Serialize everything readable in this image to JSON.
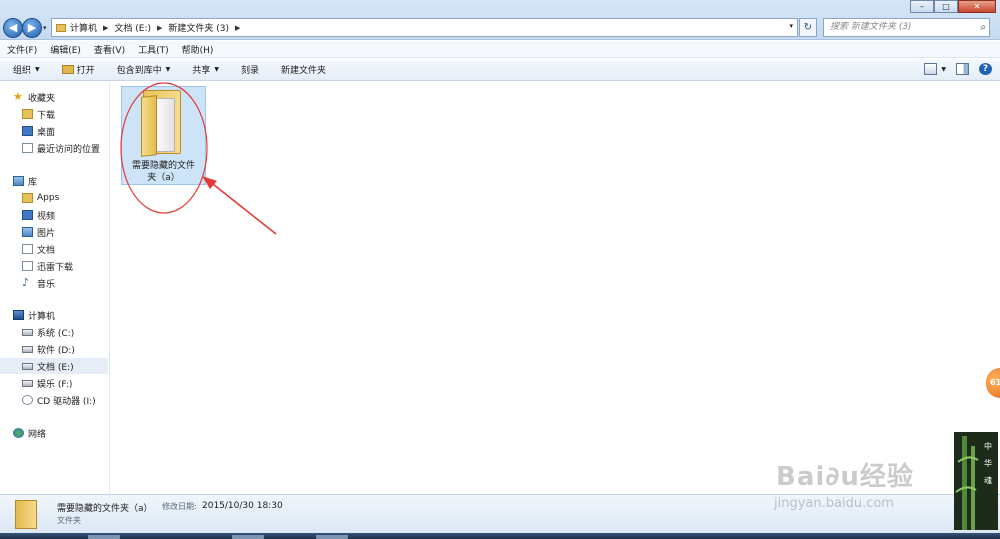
{
  "window": {
    "controls": {
      "minimize": "–",
      "maximize": "□",
      "close": "✕"
    }
  },
  "nav": {
    "back_glyph": "◀",
    "forward_glyph": "▶",
    "dropdown_glyph": "▾",
    "refresh_glyph": "↻"
  },
  "address": {
    "crumbs": [
      {
        "label": "计算机"
      },
      {
        "label": "文档 (E:)"
      },
      {
        "label": "新建文件夹 (3)"
      }
    ],
    "separator": "▶",
    "dropdown": "▾"
  },
  "search": {
    "placeholder": "搜索 新建文件夹 (3)",
    "icon": "search-icon"
  },
  "menubar": [
    "文件(F)",
    "编辑(E)",
    "查看(V)",
    "工具(T)",
    "帮助(H)"
  ],
  "toolbar": {
    "organize": "组织",
    "open": "打开",
    "include_in_library": "包含到库中",
    "share": "共享",
    "burn": "刻录",
    "new_folder": "新建文件夹",
    "caret": "▼",
    "help": "?"
  },
  "sidebar": {
    "favorites": {
      "title": "收藏夹",
      "items": [
        "下载",
        "桌面",
        "最近访问的位置"
      ]
    },
    "libraries": {
      "title": "库",
      "items": [
        "Apps",
        "视频",
        "图片",
        "文档",
        "迅雷下载",
        "音乐"
      ]
    },
    "computer": {
      "title": "计算机",
      "items": [
        "系统 (C:)",
        "软件 (D:)",
        "文档 (E:)",
        "娱乐 (F:)",
        "CD 驱动器 (I:)"
      ],
      "selected": "文档 (E:)"
    },
    "network": {
      "title": "网络"
    }
  },
  "content": {
    "folder": {
      "name": "需要隐藏的文件夹（a）",
      "name_line1": "需要隐藏的文件",
      "name_line2": "夹（a）"
    }
  },
  "status": {
    "name": "需要隐藏的文件夹（a）",
    "modified_label": "修改日期:",
    "modified_value": "2015/10/30 18:30",
    "type": "文件夹"
  },
  "overlay": {
    "badge": "61",
    "watermark_main": "Bai∂u经验",
    "watermark_sub": "jingyan.baidu.com",
    "bamboo_text": [
      "中",
      "华",
      "魂"
    ]
  },
  "colors": {
    "annotation_red": "#e53935",
    "selection_blue": "#cde3f8",
    "accent": "#1e63b6"
  }
}
